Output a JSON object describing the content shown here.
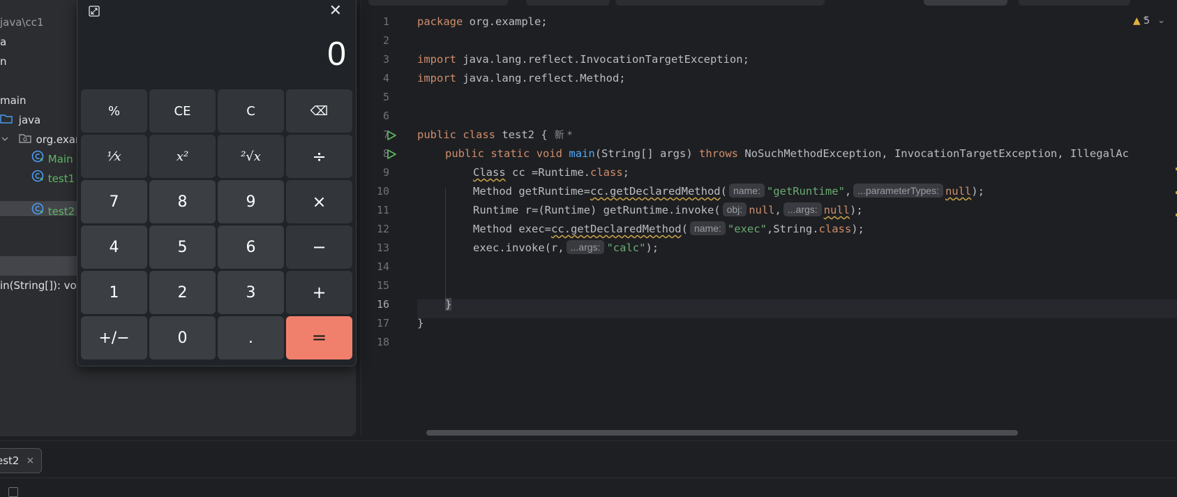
{
  "project_panel": {
    "path_fragment": "java\\cc1",
    "rows": [
      "a",
      "n",
      "main",
      "java",
      "org.exam",
      "Main",
      "test1",
      "test2"
    ],
    "structure_item": "in(String[]): voic"
  },
  "editor": {
    "warnings_count": "5",
    "line_numbers": [
      "1",
      "2",
      "3",
      "4",
      "5",
      "6",
      "7",
      "8",
      "9",
      "10",
      "11",
      "12",
      "13",
      "14",
      "15",
      "16",
      "17",
      "18"
    ],
    "lines": {
      "l1": {
        "kw": "package",
        "rest": " org.example;"
      },
      "l3": {
        "kw": "import",
        "rest": " java.lang.reflect.InvocationTargetException;"
      },
      "l4": {
        "kw": "import",
        "rest": " java.lang.reflect.Method;"
      },
      "l7": {
        "kw1": "public",
        "kw2": "class",
        "rest": " test2 {",
        "hint": "新 *"
      },
      "l8": {
        "kw1": "public",
        "kw2": "static",
        "kw3": "void",
        "fn": "main",
        "args": "(String[] args) ",
        "kw4": "throws",
        "rest": " NoSuchMethodException, InvocationTargetException, IllegalAc"
      },
      "l9": {
        "type": "Class",
        "mid": " cc =Runtime.",
        "kw": "class",
        "end": ";"
      },
      "l10": {
        "pre": "Method getRuntime=",
        "call": "cc.getDeclaredMethod",
        "open": "(",
        "hint1": "name:",
        "str": "\"getRuntime\"",
        "comma": ",",
        "hint2": "...parameterTypes:",
        "null": "null",
        "end": ");"
      },
      "l11": {
        "pre": "Runtime r=(Runtime) getRuntime.invoke(",
        "hint1": "obj:",
        "null1": "null",
        "comma": ",",
        "hint2": "...args:",
        "null2": "null",
        "end": ");"
      },
      "l12": {
        "pre": "Method exec=",
        "call": "cc.getDeclaredMethod",
        "open": "(",
        "hint1": "name:",
        "str": "\"exec\"",
        "mid": ",String.",
        "kw": "class",
        "end": ");"
      },
      "l13": {
        "pre": "exec.invoke(r,",
        "hint1": "...args:",
        "str": "\"calc\"",
        "end": ");"
      },
      "l16": {
        "brace": "}"
      },
      "l17": {
        "brace": "}"
      }
    }
  },
  "bottom": {
    "run_tab_label": "est2",
    "run_tab_close": "×"
  },
  "calculator": {
    "display_value": "0",
    "close_glyph": "✕",
    "keys": [
      {
        "label": "%",
        "kind": "fn-key",
        "name": "percent-key"
      },
      {
        "label": "CE",
        "kind": "fn-key",
        "name": "clear-entry-key"
      },
      {
        "label": "C",
        "kind": "fn-key",
        "name": "clear-key"
      },
      {
        "label": "⌫",
        "kind": "fn-key",
        "name": "backspace-key"
      },
      {
        "label": "⅟x",
        "kind": "fn-key",
        "name": "reciprocal-key"
      },
      {
        "label": "x²",
        "kind": "fn-key",
        "name": "square-key"
      },
      {
        "label": "²√x",
        "kind": "fn-key",
        "name": "square-root-key"
      },
      {
        "label": "÷",
        "kind": "op",
        "name": "divide-key"
      },
      {
        "label": "7",
        "kind": "num",
        "name": "digit-7-key"
      },
      {
        "label": "8",
        "kind": "num",
        "name": "digit-8-key"
      },
      {
        "label": "9",
        "kind": "num",
        "name": "digit-9-key"
      },
      {
        "label": "×",
        "kind": "op",
        "name": "multiply-key"
      },
      {
        "label": "4",
        "kind": "num",
        "name": "digit-4-key"
      },
      {
        "label": "5",
        "kind": "num",
        "name": "digit-5-key"
      },
      {
        "label": "6",
        "kind": "num",
        "name": "digit-6-key"
      },
      {
        "label": "−",
        "kind": "op",
        "name": "subtract-key"
      },
      {
        "label": "1",
        "kind": "num",
        "name": "digit-1-key"
      },
      {
        "label": "2",
        "kind": "num",
        "name": "digit-2-key"
      },
      {
        "label": "3",
        "kind": "num",
        "name": "digit-3-key"
      },
      {
        "label": "+",
        "kind": "op",
        "name": "add-key"
      },
      {
        "label": "+/−",
        "kind": "num",
        "name": "negate-key"
      },
      {
        "label": "0",
        "kind": "num",
        "name": "digit-0-key"
      },
      {
        "label": ".",
        "kind": "num",
        "name": "decimal-key"
      },
      {
        "label": "=",
        "kind": "eq",
        "name": "equals-key"
      }
    ]
  },
  "colors": {
    "equals_accent": "#f0806c",
    "keyword": "#cf8e6d",
    "string": "#6aab73",
    "function": "#56a8f5",
    "warning": "#e0b13e",
    "run_green": "#5fb865"
  }
}
